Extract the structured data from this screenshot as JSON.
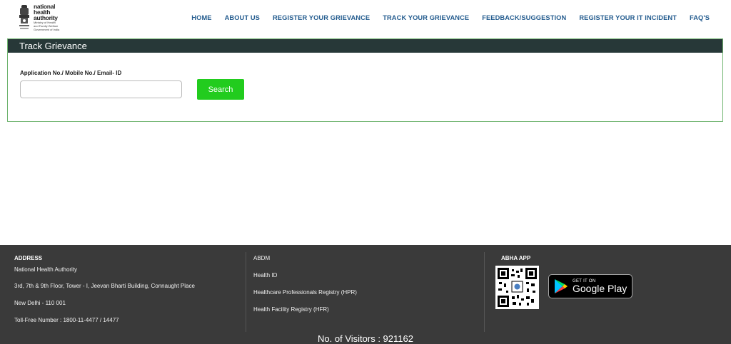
{
  "logo": {
    "line1": "national",
    "line2": "health",
    "line3": "authority",
    "sub1": "Ministry of Health",
    "sub2": "and Family Welfare",
    "sub3": "Government of India"
  },
  "nav": {
    "items": [
      {
        "label": "HOME"
      },
      {
        "label": "ABOUT US"
      },
      {
        "label": "REGISTER YOUR GRIEVANCE"
      },
      {
        "label": "TRACK YOUR GRIEVANCE"
      },
      {
        "label": "FEEDBACK/SUGGESTION"
      },
      {
        "label": "REGISTER YOUR IT INCIDENT"
      },
      {
        "label": "FAQ'S"
      }
    ]
  },
  "panel": {
    "title": "Track Grievance",
    "field_label": "Application No./ Mobile No./ Email- ID",
    "field_value": "",
    "search_label": "Search"
  },
  "footer": {
    "address": {
      "title": "ADDRESS",
      "lines": [
        "National Health Authority",
        "3rd, 7th & 9th Floor, Tower - I, Jeevan Bharti Building, Connaught Place",
        "New Delhi - 110 001",
        "Toll-Free Number : 1800-11-4477 / 14477"
      ]
    },
    "links": {
      "items": [
        {
          "label": "ABDM"
        },
        {
          "label": "Health ID"
        },
        {
          "label": "Healthcare Professionals Registry (HPR)"
        },
        {
          "label": "Health Facility Registry (HFR)"
        }
      ]
    },
    "app": {
      "title": "ABHA APP",
      "gplay_small": "GET IT ON",
      "gplay_big": "Google Play"
    },
    "visitors": "No. of Visitors : 921162"
  },
  "colors": {
    "nav_text": "#245c8f",
    "panel_header": "#273838",
    "panel_border": "#6db36d",
    "search_button": "#22cc1e",
    "footer_bg": "#3a3a3a"
  }
}
